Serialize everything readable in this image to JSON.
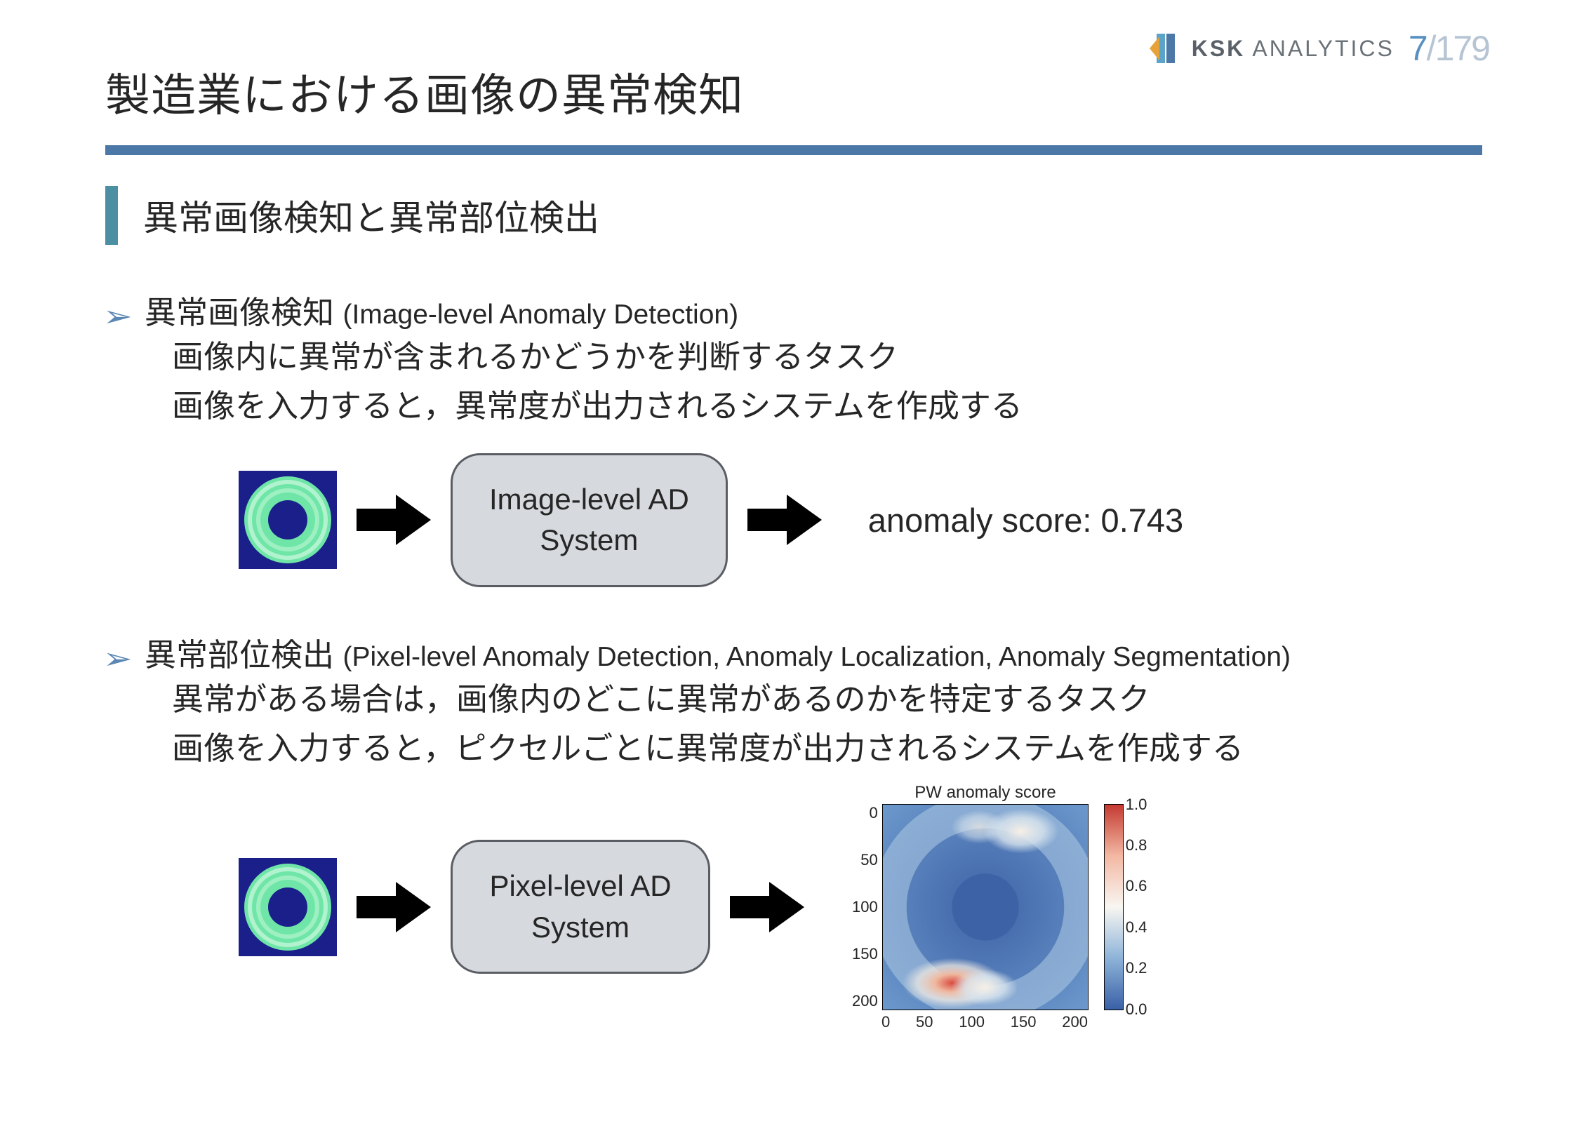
{
  "header": {
    "logo_bold": "KSK",
    "logo_light": " ANALYTICS",
    "page_current": "7",
    "page_total": "179"
  },
  "title": "製造業における画像の異常検知",
  "subtitle": "異常画像検知と異常部位検出",
  "section1": {
    "head_jp": "異常画像検知 ",
    "head_paren": "(Image-level Anomaly Detection)",
    "body_line1": "画像内に異常が含まれるかどうかを判断するタスク",
    "body_line2": "画像を入力すると，異常度が出力されるシステムを作成する",
    "sys_line1": "Image-level AD",
    "sys_line2": "System",
    "score": "anomaly score: 0.743"
  },
  "section2": {
    "head_jp": "異常部位検出 ",
    "head_paren": "(Pixel-level Anomaly Detection, Anomaly Localization, Anomaly Segmentation)",
    "body_line1": "異常がある場合は，画像内のどこに異常があるのかを特定するタスク",
    "body_line2": "画像を入力すると，ピクセルごとに異常度が出力されるシステムを作成する",
    "sys_line1": "Pixel-level AD",
    "sys_line2": "System",
    "heatmap_title": "PW anomaly score",
    "yticks": [
      "0",
      "50",
      "100",
      "150",
      "200"
    ],
    "xticks": [
      "0",
      "50",
      "100",
      "150",
      "200"
    ],
    "cbar_ticks": [
      "1.0",
      "0.8",
      "0.6",
      "0.4",
      "0.2",
      "0.0"
    ]
  },
  "chart_data": {
    "type": "heatmap",
    "title": "PW anomaly score",
    "xlabel": "",
    "ylabel": "",
    "xlim": [
      0,
      224
    ],
    "ylim": [
      0,
      224
    ],
    "colorbar_range": [
      0.0,
      1.0
    ],
    "description": "Per-pixel anomaly score heatmap. Background mostly low (~0.1–0.3, blue). A circular ring region around center. Highest anomaly (~0.8–1.0, red/white) near lower-left arc around (55,190)–(110,200) and a moderate spot near top-right arc (~150,25). Center disk is low.",
    "hotspots": [
      {
        "x": 75,
        "y": 195,
        "value": 0.92
      },
      {
        "x": 110,
        "y": 200,
        "value": 0.72
      },
      {
        "x": 150,
        "y": 28,
        "value": 0.55
      },
      {
        "x": 105,
        "y": 25,
        "value": 0.45
      }
    ]
  }
}
